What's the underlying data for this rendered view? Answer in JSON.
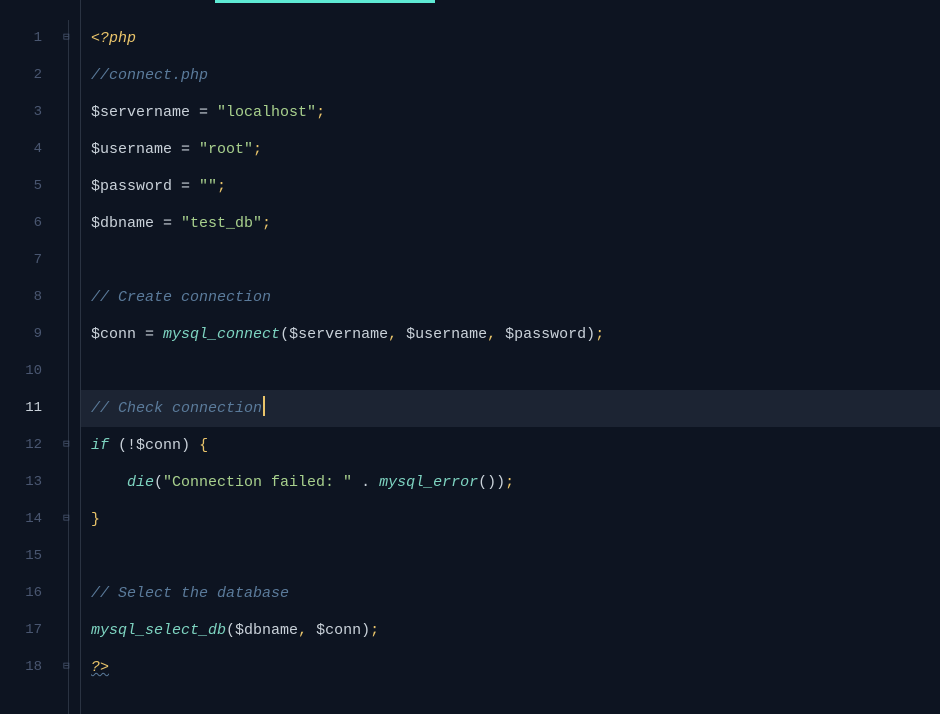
{
  "lines": {
    "l1_tag": "<?php",
    "l2_comment": "//connect.php",
    "l3_var": "$servername",
    "l3_val": "\"localhost\"",
    "l4_var": "$username",
    "l4_val": "\"root\"",
    "l5_var": "$password",
    "l5_val": "\"\"",
    "l6_var": "$dbname",
    "l6_val": "\"test_db\"",
    "l8_comment": "// Create connection",
    "l9_var": "$conn",
    "l9_func": "mysql_connect",
    "l9_arg1": "$servername",
    "l9_arg2": "$username",
    "l9_arg3": "$password",
    "l11_comment": "// Check connection",
    "l12_kw": "if",
    "l12_var": "$conn",
    "l13_func": "die",
    "l13_str": "\"Connection failed: \"",
    "l13_func2": "mysql_error",
    "l16_comment": "// Select the database",
    "l17_func": "mysql_select_db",
    "l17_arg1": "$dbname",
    "l17_arg2": "$conn",
    "l18_tag": "?>"
  },
  "line_numbers": [
    "1",
    "2",
    "3",
    "4",
    "5",
    "6",
    "7",
    "8",
    "9",
    "10",
    "11",
    "12",
    "13",
    "14",
    "15",
    "16",
    "17",
    "18"
  ],
  "active_line": 11,
  "fold_markers": {
    "1": "⊟",
    "12": "⊟",
    "14": "⊟",
    "18": "⊟"
  }
}
